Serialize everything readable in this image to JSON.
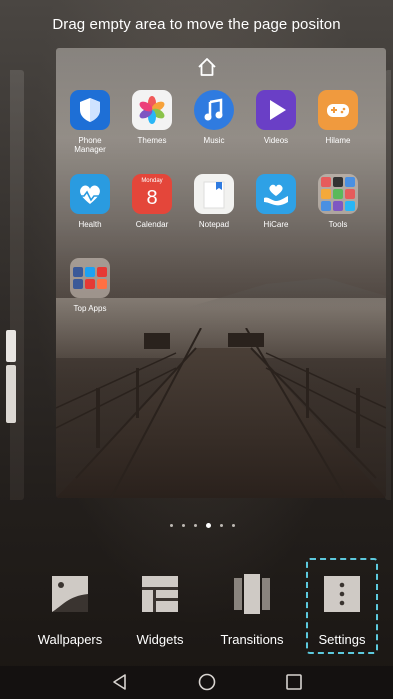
{
  "hint": "Drag empty area to move the page positon",
  "apps": [
    {
      "name": "phone-manager",
      "label": "Phone Manager"
    },
    {
      "name": "themes",
      "label": "Themes"
    },
    {
      "name": "music",
      "label": "Music"
    },
    {
      "name": "videos",
      "label": "Videos"
    },
    {
      "name": "hiGame",
      "label": "Hilame"
    },
    {
      "name": "health",
      "label": "Health"
    },
    {
      "name": "calendar",
      "label": "Calendar",
      "day": "Monday",
      "date": "8"
    },
    {
      "name": "notepad",
      "label": "Notepad"
    },
    {
      "name": "hicare",
      "label": "HiCare"
    },
    {
      "name": "tools",
      "label": "Tools"
    },
    {
      "name": "top-apps",
      "label": "Top Apps"
    }
  ],
  "page_indicator": {
    "count": 6,
    "active_index": 3
  },
  "menu": [
    {
      "name": "wallpapers",
      "label": "Wallpapers"
    },
    {
      "name": "widgets",
      "label": "Widgets"
    },
    {
      "name": "transitions",
      "label": "Transitions"
    },
    {
      "name": "settings",
      "label": "Settings"
    }
  ],
  "highlight_color": "#5cc9dd",
  "nav": [
    "back-icon",
    "home-icon",
    "recents-icon"
  ]
}
